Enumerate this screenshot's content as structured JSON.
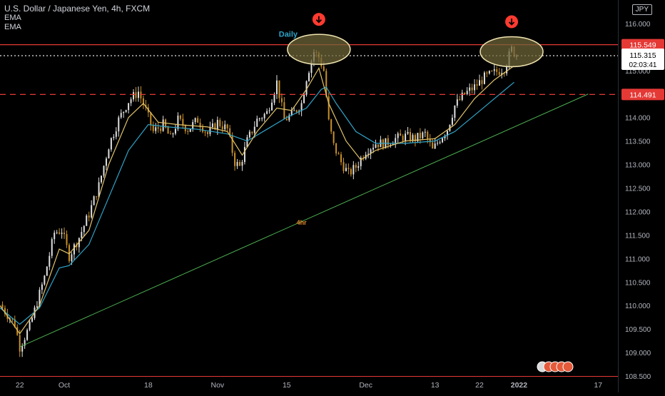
{
  "header": {
    "symbol_line": "U.S. Dollar / Japanese Yen, 4h, FXCM",
    "indicator_1": "EMA",
    "indicator_2": "EMA",
    "currency": "JPY"
  },
  "colors": {
    "background": "#000000",
    "candle_up": "#e0e0e0",
    "candle_down": "#c8902a",
    "ema_fast": "#e3c46a",
    "ema_slow": "#2fa3c8",
    "resistance": "#e53935",
    "trendline": "#4caf50",
    "ellipse_fill": "#6e6438",
    "arrow": "#ff3b30",
    "annotation_daily": "#2fa3c8",
    "annotation_4hr": "#e08a2c",
    "price_badge_bg": "#ffffff",
    "axis_text": "#b2b5be"
  },
  "price_box": {
    "price": "115.315",
    "countdown": "02:03:41"
  },
  "chart_data": {
    "type": "candlestick",
    "title": "U.S. Dollar / Japanese Yen, 4h, FXCM",
    "ylim": [
      108.5,
      116.5
    ],
    "y_ticks": [
      "116.000",
      "115.500",
      "115.000",
      "114.500",
      "114.000",
      "113.500",
      "113.000",
      "112.500",
      "112.000",
      "111.500",
      "111.000",
      "110.500",
      "110.000",
      "109.500",
      "109.000",
      "108.500"
    ],
    "x_ticks": [
      "22",
      "Oct",
      "18",
      "Nov",
      "15",
      "Dec",
      "13",
      "22",
      "2022",
      "17"
    ],
    "x_tick_days": [
      0,
      9,
      26,
      40,
      54,
      70,
      84,
      93,
      101,
      117
    ],
    "x_range_days": [
      -4,
      121
    ],
    "price_path": [
      [
        -4,
        110.02
      ],
      [
        -1,
        109.6
      ],
      [
        0,
        109.12
      ],
      [
        2,
        109.55
      ],
      [
        5,
        110.6
      ],
      [
        7,
        111.55
      ],
      [
        8.5,
        111.6
      ],
      [
        10,
        111.05
      ],
      [
        12,
        111.45
      ],
      [
        14,
        111.95
      ],
      [
        16,
        112.55
      ],
      [
        18,
        113.4
      ],
      [
        20,
        113.95
      ],
      [
        22,
        114.35
      ],
      [
        24,
        114.55
      ],
      [
        25.5,
        114.15
      ],
      [
        27,
        113.7
      ],
      [
        29,
        113.85
      ],
      [
        30.5,
        113.55
      ],
      [
        32,
        113.95
      ],
      [
        34,
        113.75
      ],
      [
        36,
        113.95
      ],
      [
        38,
        113.65
      ],
      [
        40,
        113.9
      ],
      [
        42,
        113.75
      ],
      [
        43.5,
        113.05
      ],
      [
        44.5,
        112.95
      ],
      [
        46,
        113.5
      ],
      [
        48,
        113.95
      ],
      [
        50,
        114.1
      ],
      [
        52,
        114.75
      ],
      [
        53.5,
        113.95
      ],
      [
        55,
        114.05
      ],
      [
        57,
        114.3
      ],
      [
        58,
        114.85
      ],
      [
        59.5,
        115.4
      ],
      [
        60.5,
        115.28
      ],
      [
        61.5,
        115.0
      ],
      [
        62.5,
        113.9
      ],
      [
        63.5,
        113.4
      ],
      [
        65,
        113.05
      ],
      [
        66.5,
        112.8
      ],
      [
        68,
        112.95
      ],
      [
        70,
        113.3
      ],
      [
        72,
        113.45
      ],
      [
        74,
        113.45
      ],
      [
        76,
        113.55
      ],
      [
        78,
        113.6
      ],
      [
        80,
        113.55
      ],
      [
        82,
        113.65
      ],
      [
        83.5,
        113.3
      ],
      [
        85,
        113.55
      ],
      [
        86.5,
        113.75
      ],
      [
        88,
        114.25
      ],
      [
        90,
        114.5
      ],
      [
        92,
        114.65
      ],
      [
        94,
        114.85
      ],
      [
        96,
        114.95
      ],
      [
        98,
        115.05
      ],
      [
        99.5,
        115.45
      ],
      [
        100.5,
        115.31
      ]
    ],
    "ema_fast": [
      [
        -4,
        110.0
      ],
      [
        0,
        109.4
      ],
      [
        4,
        110.0
      ],
      [
        8,
        111.2
      ],
      [
        10,
        111.1
      ],
      [
        14,
        111.6
      ],
      [
        18,
        113.0
      ],
      [
        22,
        114.0
      ],
      [
        25,
        114.3
      ],
      [
        28,
        113.9
      ],
      [
        32,
        113.85
      ],
      [
        38,
        113.8
      ],
      [
        42,
        113.7
      ],
      [
        45,
        113.2
      ],
      [
        48,
        113.7
      ],
      [
        52,
        114.2
      ],
      [
        55,
        114.15
      ],
      [
        58,
        114.6
      ],
      [
        60.5,
        115.05
      ],
      [
        62.5,
        114.3
      ],
      [
        66,
        113.5
      ],
      [
        69,
        113.1
      ],
      [
        72,
        113.3
      ],
      [
        78,
        113.5
      ],
      [
        84,
        113.55
      ],
      [
        88,
        113.85
      ],
      [
        92,
        114.4
      ],
      [
        96,
        114.8
      ],
      [
        100,
        115.1
      ]
    ],
    "ema_slow": [
      [
        -4,
        109.95
      ],
      [
        0,
        109.6
      ],
      [
        4,
        109.95
      ],
      [
        8,
        110.8
      ],
      [
        10,
        110.85
      ],
      [
        14,
        111.3
      ],
      [
        18,
        112.3
      ],
      [
        22,
        113.3
      ],
      [
        26,
        113.85
      ],
      [
        30,
        113.8
      ],
      [
        36,
        113.75
      ],
      [
        42,
        113.65
      ],
      [
        46,
        113.5
      ],
      [
        50,
        113.75
      ],
      [
        54,
        114.0
      ],
      [
        58,
        114.2
      ],
      [
        61,
        114.6
      ],
      [
        62,
        114.65
      ],
      [
        64,
        114.3
      ],
      [
        68,
        113.7
      ],
      [
        72,
        113.45
      ],
      [
        78,
        113.45
      ],
      [
        84,
        113.5
      ],
      [
        88,
        113.7
      ],
      [
        92,
        114.05
      ],
      [
        96,
        114.4
      ],
      [
        100,
        114.75
      ]
    ],
    "horizontal_lines": [
      {
        "price": 115.549,
        "label": "115.549",
        "style": "solid"
      },
      {
        "price": 114.491,
        "label": "114.491",
        "style": "dashed"
      }
    ],
    "current_price": 115.315,
    "trendline": {
      "start": [
        0,
        109.12
      ],
      "end": [
        115,
        114.5
      ]
    },
    "highlight_ellipses": [
      {
        "day": 60.5,
        "price": 115.45
      },
      {
        "day": 99.5,
        "price": 115.4
      }
    ],
    "annotations": [
      {
        "text": "Daily",
        "day": 54.3,
        "price": 115.72
      },
      {
        "text": "4hr",
        "day": 57,
        "price": 111.72
      }
    ]
  }
}
